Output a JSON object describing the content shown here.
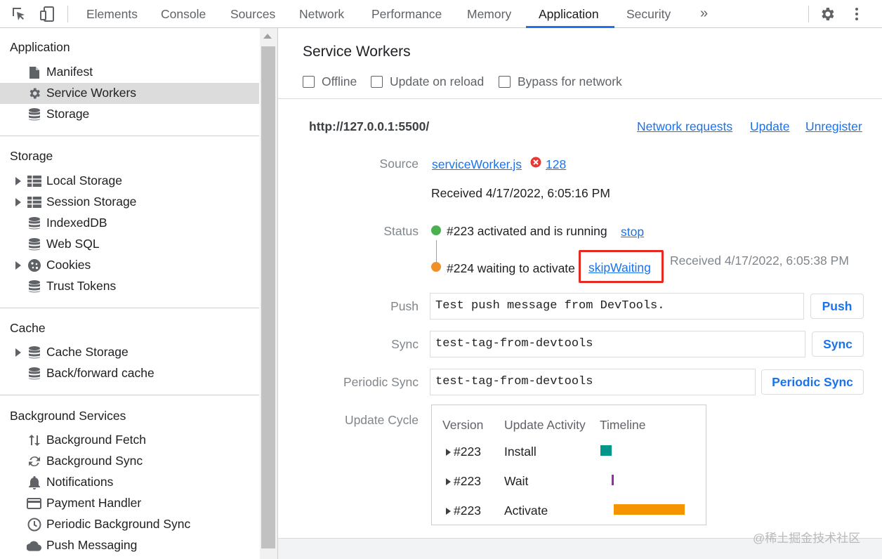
{
  "tabs": [
    "Elements",
    "Console",
    "Sources",
    "Network",
    "Performance",
    "Memory",
    "Application",
    "Security"
  ],
  "active_tab": "Application",
  "icons": {
    "inspect": "inspect-element-icon",
    "device": "device-toolbar-icon",
    "more_tabs": "more-tabs-icon",
    "settings": "gear-icon",
    "menu": "kebab-menu-icon"
  },
  "more_tabs_glyph": "»",
  "sidebar": {
    "application": {
      "heading": "Application",
      "items": [
        {
          "label": "Manifest",
          "icon": "file-icon"
        },
        {
          "label": "Service Workers",
          "icon": "gear-icon"
        },
        {
          "label": "Storage",
          "icon": "database-icon"
        }
      ]
    },
    "storage": {
      "heading": "Storage",
      "items": [
        {
          "label": "Local Storage",
          "icon": "table-icon"
        },
        {
          "label": "Session Storage",
          "icon": "table-icon"
        },
        {
          "label": "IndexedDB",
          "icon": "database-icon"
        },
        {
          "label": "Web SQL",
          "icon": "database-icon"
        },
        {
          "label": "Cookies",
          "icon": "cookie-icon"
        },
        {
          "label": "Trust Tokens",
          "icon": "database-icon"
        }
      ]
    },
    "cache": {
      "heading": "Cache",
      "items": [
        {
          "label": "Cache Storage",
          "icon": "database-icon"
        },
        {
          "label": "Back/forward cache",
          "icon": "database-icon"
        }
      ]
    },
    "background": {
      "heading": "Background Services",
      "items": [
        {
          "label": "Background Fetch",
          "icon": "up-down-arrows-icon"
        },
        {
          "label": "Background Sync",
          "icon": "sync-icon"
        },
        {
          "label": "Notifications",
          "icon": "bell-icon"
        },
        {
          "label": "Payment Handler",
          "icon": "credit-card-icon"
        },
        {
          "label": "Periodic Background Sync",
          "icon": "clock-icon"
        },
        {
          "label": "Push Messaging",
          "icon": "cloud-icon"
        }
      ]
    }
  },
  "main": {
    "title": "Service Workers",
    "checkboxes": [
      "Offline",
      "Update on reload",
      "Bypass for network"
    ],
    "origin": "http://127.0.0.1:5500/",
    "header_links": [
      "Network requests",
      "Update",
      "Unregister"
    ],
    "source_label": "Source",
    "source_file": "serviceWorker.js",
    "error_count": "128",
    "received_1": "Received 4/17/2022, 6:05:16 PM",
    "status_label": "Status",
    "status_1": "#223 activated and is running",
    "status_1_link": "stop",
    "status_1_color": "#4caf50",
    "status_2": "#224 waiting to activate",
    "status_2_link": "skipWaiting",
    "status_2_color": "#f0902a",
    "received_2": "Received 4/17/2022, 6:05:38 PM",
    "push_label": "Push",
    "push_value": "Test push message from DevTools.",
    "push_button": "Push",
    "sync_label": "Sync",
    "sync_value": "test-tag-from-devtools",
    "sync_button": "Sync",
    "periodic_label": "Periodic Sync",
    "periodic_value": "test-tag-from-devtools",
    "periodic_button": "Periodic Sync",
    "update_cycle_label": "Update Cycle",
    "update_cycle": {
      "headers": [
        "Version",
        "Update Activity",
        "Timeline"
      ],
      "rows": [
        {
          "version": "#223",
          "activity": "Install",
          "bar_color": "#009688"
        },
        {
          "version": "#223",
          "activity": "Wait",
          "bar_color": "#9c27b0"
        },
        {
          "version": "#223",
          "activity": "Activate",
          "bar_color": "#f59300"
        }
      ]
    }
  },
  "watermark": "@稀土掘金技术社区"
}
